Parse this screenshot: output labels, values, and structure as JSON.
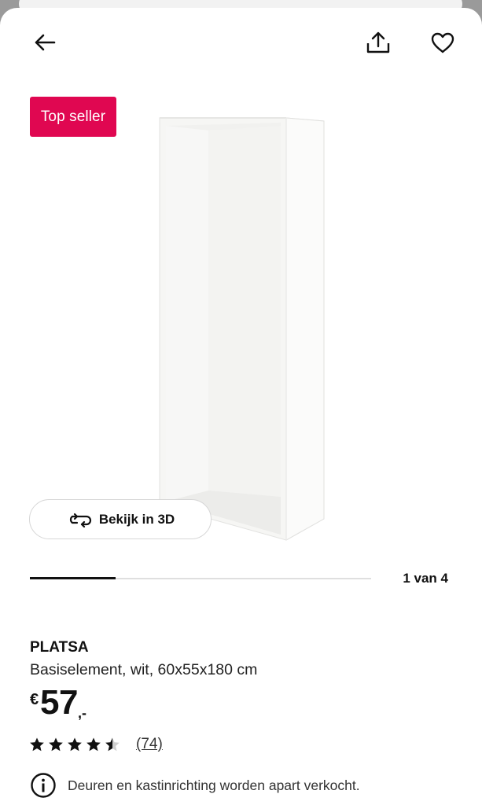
{
  "header": {
    "back_icon": "arrow-left-icon",
    "share_icon": "share-upload-icon",
    "favorite_icon": "heart-outline-icon"
  },
  "badge": {
    "label": "Top seller",
    "color": "#e00751"
  },
  "viewer": {
    "button_label": "Bekijk in 3D",
    "button_icon": "rotate-3d-icon",
    "progress": 0.25,
    "page_indicator": "1 van 4"
  },
  "product": {
    "name": "PLATSA",
    "description": "Basiselement, wit, 60x55x180 cm",
    "price": {
      "currency": "€",
      "integer": "57",
      "decimal": ",-"
    },
    "rating": {
      "stars": 4.5,
      "max": 5,
      "review_count": "(74)"
    },
    "notice": {
      "icon": "info-circle-icon",
      "text": "Deuren en kastinrichting worden apart verkocht."
    }
  }
}
